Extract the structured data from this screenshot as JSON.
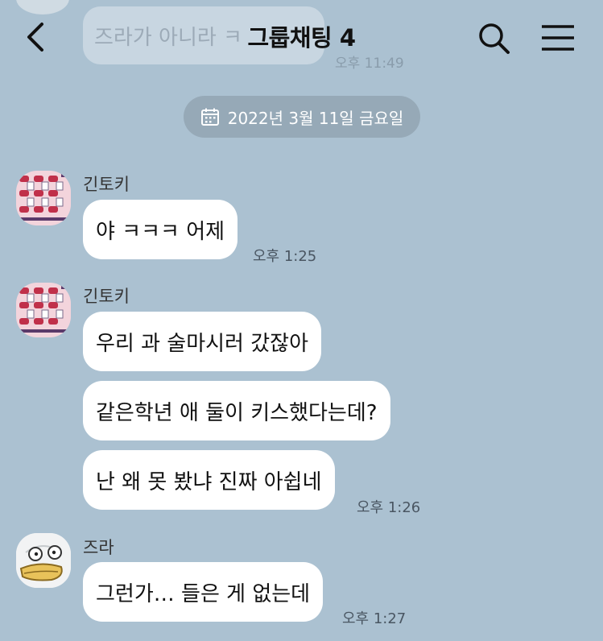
{
  "header": {
    "title": "그룹채팅 4"
  },
  "ghost": {
    "text": "즈라가 아니라 ㅋ",
    "time": "오후 11:49"
  },
  "date_divider": "2022년 3월 11일 금요일",
  "messages": [
    {
      "sender": "긴토키",
      "bubbles": [
        "야 ㅋㅋㅋ 어제"
      ],
      "time": "오후 1:25"
    },
    {
      "sender": "긴토키",
      "bubbles": [
        "우리 과 술마시러 갔잖아",
        "같은학년 애 둘이 키스했다는데?",
        "난 왜 못 봤냐 진짜 아쉽네"
      ],
      "time": "오후 1:26"
    },
    {
      "sender": "즈라",
      "bubbles": [
        "그런가… 들은 게 없는데"
      ],
      "time": "오후 1:27"
    }
  ],
  "colors": {
    "background": "#abc1d1",
    "bubble": "#ffffff",
    "date_pill": "#96a9b7"
  },
  "icons": [
    "chevron-left-icon",
    "search-icon",
    "menu-icon",
    "calendar-icon"
  ]
}
